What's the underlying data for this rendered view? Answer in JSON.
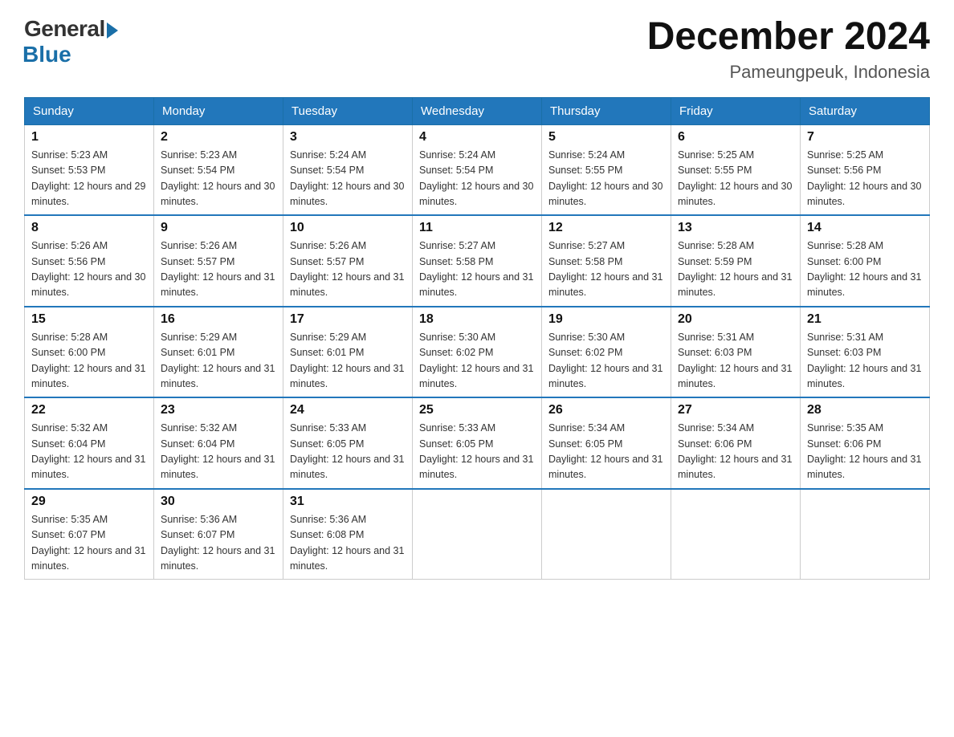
{
  "logo": {
    "general": "General",
    "blue": "Blue"
  },
  "title": "December 2024",
  "subtitle": "Pameungpeuk, Indonesia",
  "days_of_week": [
    "Sunday",
    "Monday",
    "Tuesday",
    "Wednesday",
    "Thursday",
    "Friday",
    "Saturday"
  ],
  "weeks": [
    [
      {
        "day": "1",
        "sunrise": "5:23 AM",
        "sunset": "5:53 PM",
        "daylight": "12 hours and 29 minutes."
      },
      {
        "day": "2",
        "sunrise": "5:23 AM",
        "sunset": "5:54 PM",
        "daylight": "12 hours and 30 minutes."
      },
      {
        "day": "3",
        "sunrise": "5:24 AM",
        "sunset": "5:54 PM",
        "daylight": "12 hours and 30 minutes."
      },
      {
        "day": "4",
        "sunrise": "5:24 AM",
        "sunset": "5:54 PM",
        "daylight": "12 hours and 30 minutes."
      },
      {
        "day": "5",
        "sunrise": "5:24 AM",
        "sunset": "5:55 PM",
        "daylight": "12 hours and 30 minutes."
      },
      {
        "day": "6",
        "sunrise": "5:25 AM",
        "sunset": "5:55 PM",
        "daylight": "12 hours and 30 minutes."
      },
      {
        "day": "7",
        "sunrise": "5:25 AM",
        "sunset": "5:56 PM",
        "daylight": "12 hours and 30 minutes."
      }
    ],
    [
      {
        "day": "8",
        "sunrise": "5:26 AM",
        "sunset": "5:56 PM",
        "daylight": "12 hours and 30 minutes."
      },
      {
        "day": "9",
        "sunrise": "5:26 AM",
        "sunset": "5:57 PM",
        "daylight": "12 hours and 31 minutes."
      },
      {
        "day": "10",
        "sunrise": "5:26 AM",
        "sunset": "5:57 PM",
        "daylight": "12 hours and 31 minutes."
      },
      {
        "day": "11",
        "sunrise": "5:27 AM",
        "sunset": "5:58 PM",
        "daylight": "12 hours and 31 minutes."
      },
      {
        "day": "12",
        "sunrise": "5:27 AM",
        "sunset": "5:58 PM",
        "daylight": "12 hours and 31 minutes."
      },
      {
        "day": "13",
        "sunrise": "5:28 AM",
        "sunset": "5:59 PM",
        "daylight": "12 hours and 31 minutes."
      },
      {
        "day": "14",
        "sunrise": "5:28 AM",
        "sunset": "6:00 PM",
        "daylight": "12 hours and 31 minutes."
      }
    ],
    [
      {
        "day": "15",
        "sunrise": "5:28 AM",
        "sunset": "6:00 PM",
        "daylight": "12 hours and 31 minutes."
      },
      {
        "day": "16",
        "sunrise": "5:29 AM",
        "sunset": "6:01 PM",
        "daylight": "12 hours and 31 minutes."
      },
      {
        "day": "17",
        "sunrise": "5:29 AM",
        "sunset": "6:01 PM",
        "daylight": "12 hours and 31 minutes."
      },
      {
        "day": "18",
        "sunrise": "5:30 AM",
        "sunset": "6:02 PM",
        "daylight": "12 hours and 31 minutes."
      },
      {
        "day": "19",
        "sunrise": "5:30 AM",
        "sunset": "6:02 PM",
        "daylight": "12 hours and 31 minutes."
      },
      {
        "day": "20",
        "sunrise": "5:31 AM",
        "sunset": "6:03 PM",
        "daylight": "12 hours and 31 minutes."
      },
      {
        "day": "21",
        "sunrise": "5:31 AM",
        "sunset": "6:03 PM",
        "daylight": "12 hours and 31 minutes."
      }
    ],
    [
      {
        "day": "22",
        "sunrise": "5:32 AM",
        "sunset": "6:04 PM",
        "daylight": "12 hours and 31 minutes."
      },
      {
        "day": "23",
        "sunrise": "5:32 AM",
        "sunset": "6:04 PM",
        "daylight": "12 hours and 31 minutes."
      },
      {
        "day": "24",
        "sunrise": "5:33 AM",
        "sunset": "6:05 PM",
        "daylight": "12 hours and 31 minutes."
      },
      {
        "day": "25",
        "sunrise": "5:33 AM",
        "sunset": "6:05 PM",
        "daylight": "12 hours and 31 minutes."
      },
      {
        "day": "26",
        "sunrise": "5:34 AM",
        "sunset": "6:05 PM",
        "daylight": "12 hours and 31 minutes."
      },
      {
        "day": "27",
        "sunrise": "5:34 AM",
        "sunset": "6:06 PM",
        "daylight": "12 hours and 31 minutes."
      },
      {
        "day": "28",
        "sunrise": "5:35 AM",
        "sunset": "6:06 PM",
        "daylight": "12 hours and 31 minutes."
      }
    ],
    [
      {
        "day": "29",
        "sunrise": "5:35 AM",
        "sunset": "6:07 PM",
        "daylight": "12 hours and 31 minutes."
      },
      {
        "day": "30",
        "sunrise": "5:36 AM",
        "sunset": "6:07 PM",
        "daylight": "12 hours and 31 minutes."
      },
      {
        "day": "31",
        "sunrise": "5:36 AM",
        "sunset": "6:08 PM",
        "daylight": "12 hours and 31 minutes."
      },
      null,
      null,
      null,
      null
    ]
  ]
}
